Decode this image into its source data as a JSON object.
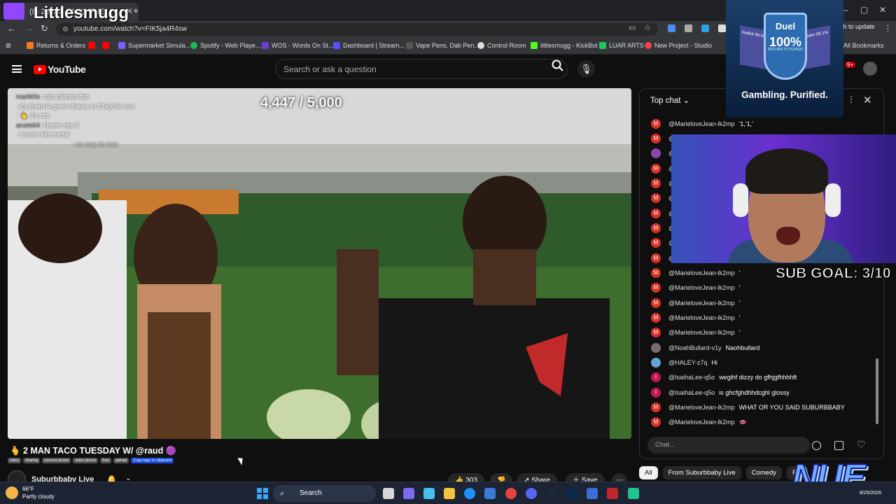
{
  "browser": {
    "tab_title": "(8) 2 MAN TACO TUE",
    "url": "youtube.com/watch?v=FIK5ja4R4sw",
    "update_label": "nch to update",
    "bookmarks": [
      {
        "label": "Returns & Orders",
        "color": "#f97a1f"
      },
      {
        "label": "Supermarket Simula...",
        "color": "#7b61ff"
      },
      {
        "label": "Spotify - Web Playe...",
        "color": "#1db954"
      },
      {
        "label": "WOS - Words On St...",
        "color": "#6a3fd4"
      },
      {
        "label": "Dashboard | Stream...",
        "color": "#5b4cff"
      },
      {
        "label": "Vape Pens, Dab Pen...",
        "color": "#555555"
      },
      {
        "label": "Control Room",
        "color": "#dddddd"
      },
      {
        "label": "littlesmugg - KickBot",
        "color": "#53fc18"
      },
      {
        "label": "LUAR ARTS",
        "color": "#22c55e"
      },
      {
        "label": "New Project - Studio",
        "color": "#ef4444"
      }
    ],
    "all_bookmarks": "All Bookmarks"
  },
  "youtube": {
    "logo_text": "YouTube",
    "search_placeholder": "Search or ask a question",
    "notif_count": "9+"
  },
  "stream_overlay": {
    "streamer_name": "Littlesmugg",
    "goal_text": "4,447 / 5,000",
    "overlay_chat": [
      {
        "user": "martk0s",
        "text": ": nah cilantro fire"
      },
      {
        "user": "",
        "text": ": it's them lil green flakes in Chipotle rice"
      },
      {
        "user": "",
        "text": ": 👆 it's not"
      },
      {
        "user": "anele64",
        "text": ": Never see it"
      },
      {
        "user": "",
        "text": ": it taste like metal"
      },
      {
        "user": "",
        "text": ": no way its has"
      }
    ],
    "sub_goal": "SUB GOAL: 3/10",
    "brand_logo": "NUE"
  },
  "ad": {
    "brand": "Duel",
    "headline": "100%",
    "subline": "RETURN TO PLAYER",
    "left_label": "Rollbit 99.0%",
    "right_label": "Stake 99.1%",
    "tagline": "Gambling. Purified."
  },
  "video": {
    "title": "🫰 2 MAN TACO TUESDAY W/ @raud 🟣",
    "tags": [
      "video",
      "sharing",
      "camera phone",
      "video phone",
      "free",
      "upload"
    ],
    "copy_tags": "Copy tags to clipboard",
    "channel": "Suburbbaby Live",
    "likes": "303",
    "share": "Share",
    "save": "Save",
    "more": "⋯"
  },
  "chat": {
    "header": "Top chat",
    "messages": [
      {
        "initial": "M",
        "color": "#d93025",
        "name": "@MarieloveJean-lk2mp",
        "text": "'1,'1,'"
      },
      {
        "initial": "M",
        "color": "#d93025",
        "name": "@",
        "text": ""
      },
      {
        "initial": "",
        "color": "#8e44ad",
        "name": "@",
        "text": ""
      },
      {
        "initial": "M",
        "color": "#d93025",
        "name": "@",
        "text": ""
      },
      {
        "initial": "M",
        "color": "#d93025",
        "name": "@",
        "text": ""
      },
      {
        "initial": "M",
        "color": "#d93025",
        "name": "@",
        "text": ""
      },
      {
        "initial": "M",
        "color": "#d93025",
        "name": "@",
        "text": ""
      },
      {
        "initial": "M",
        "color": "#d93025",
        "name": "@",
        "text": ""
      },
      {
        "initial": "M",
        "color": "#d93025",
        "name": "@",
        "text": ""
      },
      {
        "initial": "M",
        "color": "#d93025",
        "name": "@",
        "text": ""
      },
      {
        "initial": "M",
        "color": "#d93025",
        "name": "@MarieloveJean-lk2mp",
        "text": "'"
      },
      {
        "initial": "M",
        "color": "#d93025",
        "name": "@MarieloveJean-lk2mp",
        "text": "'"
      },
      {
        "initial": "M",
        "color": "#d93025",
        "name": "@MarieloveJean-lk2mp",
        "text": "'"
      },
      {
        "initial": "M",
        "color": "#d93025",
        "name": "@MarieloveJean-lk2mp",
        "text": "'"
      },
      {
        "initial": "M",
        "color": "#d93025",
        "name": "@MarieloveJean-lk2mp",
        "text": "'"
      },
      {
        "initial": "",
        "color": "#7a6b6b",
        "name": "@NoahBullard-v1y",
        "text": "Naohbullard"
      },
      {
        "initial": "",
        "color": "#6a9fd4",
        "name": "@HALEY-z7q",
        "text": "Hi"
      },
      {
        "initial": "I",
        "color": "#c2185b",
        "name": "@IsaihaLee-q5o",
        "text": "wegihf dizzy do gfhjgfhhhhft"
      },
      {
        "initial": "I",
        "color": "#c2185b",
        "name": "@IsaihaLee-q5o",
        "text": "is ghcfghdhhdcghl glossy"
      },
      {
        "initial": "M",
        "color": "#d93025",
        "name": "@MarieloveJean-lk2mp",
        "text": "WHAT OR YOU SAID SUBURBBABY"
      },
      {
        "initial": "M",
        "color": "#d93025",
        "name": "@MarieloveJean-lk2mp",
        "text": "👄"
      }
    ],
    "input_placeholder": "Chat...",
    "chips": [
      "All",
      "From Suburbbaby Live",
      "Comedy",
      "Rel"
    ]
  },
  "taskbar": {
    "temp": "66°F",
    "weather": "Partly cloudy",
    "search": "Search",
    "date": "8/25/2026"
  }
}
